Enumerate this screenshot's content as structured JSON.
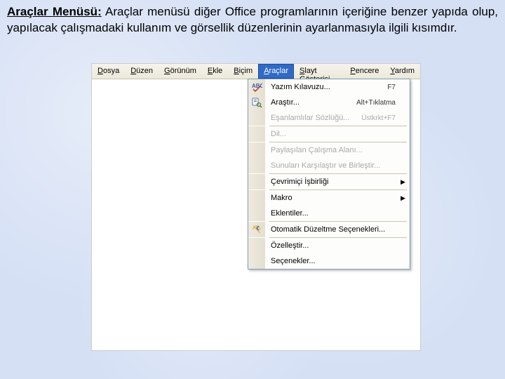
{
  "description": {
    "title": "Araçlar Menüsü:",
    "body": " Araçlar menüsü diğer Office programlarının içeriğine benzer yapıda olup, yapılacak çalışmadaki kullanım ve görsellik düzenlerinin ayarlanmasıyla ilgili kısımdır."
  },
  "menubar": {
    "items": [
      {
        "label": "Dosya",
        "u": "D"
      },
      {
        "label": "Düzen",
        "u": "D"
      },
      {
        "label": "Görünüm",
        "u": "G"
      },
      {
        "label": "Ekle",
        "u": "E"
      },
      {
        "label": "Biçim",
        "u": "B"
      },
      {
        "label": "Araçlar",
        "u": "A",
        "active": true
      },
      {
        "label": "Slayt Gösterisi",
        "u": "S"
      },
      {
        "label": "Pencere",
        "u": "P"
      },
      {
        "label": "Yardım",
        "u": "Y"
      }
    ]
  },
  "dropdown": {
    "items": [
      {
        "label": "Yazım Kılavuzu...",
        "shortcut": "F7",
        "icon": "spellcheck-icon"
      },
      {
        "label": "Araştır...",
        "shortcut": "Alt+Tıklatma",
        "icon": "research-icon"
      },
      {
        "label": "Eşanlamlılar Sözlüğü...",
        "shortcut": "Üstkrkt+F7",
        "disabled": true
      },
      {
        "sep": true
      },
      {
        "label": "Dil...",
        "disabled": true
      },
      {
        "sep": true
      },
      {
        "label": "Paylaşılan Çalışma Alanı...",
        "disabled": true
      },
      {
        "label": "Sunuları Karşılaştır ve Birleştir...",
        "disabled": true
      },
      {
        "sep": true
      },
      {
        "label": "Çevrimiçi İşbirliği",
        "submenu": true
      },
      {
        "sep": true
      },
      {
        "label": "Makro",
        "submenu": true
      },
      {
        "label": "Eklentiler..."
      },
      {
        "sep": true
      },
      {
        "label": "Otomatik Düzeltme Seçenekleri...",
        "icon": "autocorrect-icon"
      },
      {
        "sep": true
      },
      {
        "label": "Özelleştir..."
      },
      {
        "label": "Seçenekler..."
      }
    ]
  }
}
